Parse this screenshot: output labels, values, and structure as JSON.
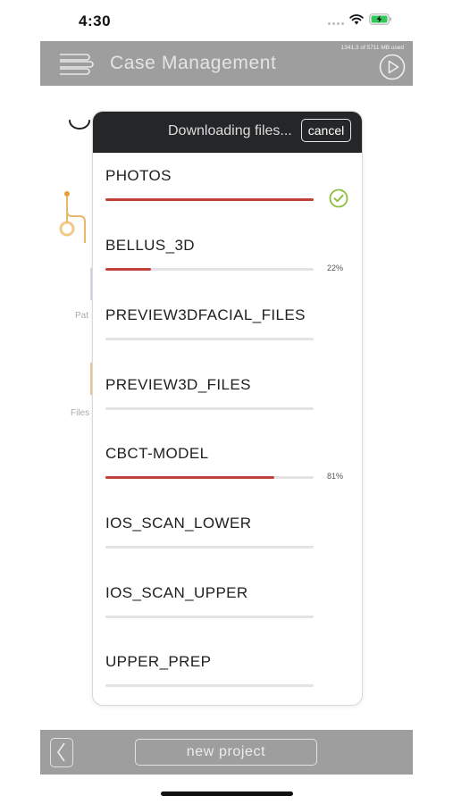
{
  "status_bar": {
    "time": "4:30"
  },
  "header": {
    "title": "Case Management",
    "storage": "1341.3 of 5711 MB used",
    "menu_icon": "hamburger-menu-icon",
    "play_icon": "play-circle-icon"
  },
  "background": {
    "item_patient": "Pat",
    "item_files": "Files"
  },
  "modal": {
    "title": "Downloading files...",
    "cancel_label": "cancel",
    "files": [
      {
        "name": "PHOTOS",
        "progress": 1.0,
        "percent_label": "",
        "complete": true
      },
      {
        "name": "BELLUS_3D",
        "progress": 0.22,
        "percent_label": "22%",
        "complete": false
      },
      {
        "name": "PREVIEW3DFACIAL_FILES",
        "progress": 0,
        "percent_label": "",
        "complete": false
      },
      {
        "name": "PREVIEW3D_FILES",
        "progress": 0,
        "percent_label": "",
        "complete": false
      },
      {
        "name": "CBCT-MODEL",
        "progress": 0.81,
        "percent_label": "81%",
        "complete": false
      },
      {
        "name": "IOS_SCAN_LOWER",
        "progress": 0,
        "percent_label": "",
        "complete": false
      },
      {
        "name": "IOS_SCAN_UPPER",
        "progress": 0,
        "percent_label": "",
        "complete": false
      },
      {
        "name": "UPPER_PREP",
        "progress": 0,
        "percent_label": "",
        "complete": false
      }
    ]
  },
  "footer": {
    "new_project_label": "new project",
    "back_icon": "chevron-left-icon"
  },
  "colors": {
    "progress": "#c0403a",
    "check": "#8bbf3c",
    "bar_bg": "#9e9e9e",
    "modal_header": "#252628"
  }
}
